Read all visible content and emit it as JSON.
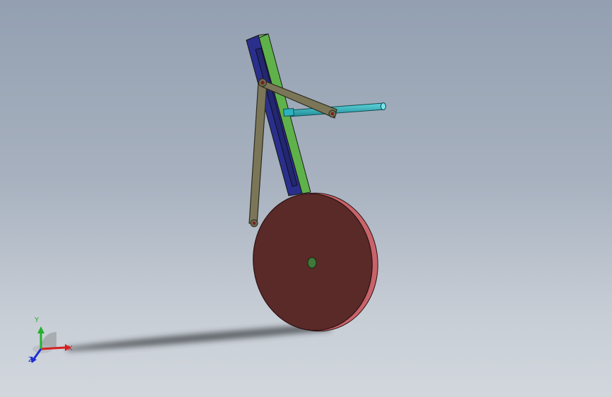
{
  "viewport": {
    "background_top": "#93a0b1",
    "background_bottom": "#d2d7de"
  },
  "model": {
    "parts": [
      {
        "name": "slotted-guide-bar",
        "color": "#2b2f8c",
        "edge_color": "#5fb24a"
      },
      {
        "name": "slider-rod",
        "color": "#2bb3bf"
      },
      {
        "name": "crank-link",
        "color": "#7b7658"
      },
      {
        "name": "connecting-link",
        "color": "#7b7658"
      },
      {
        "name": "flywheel-disc",
        "color": "#5a2a28",
        "rim_color": "#c9636a"
      },
      {
        "name": "disc-hub",
        "color": "#3f7a3a"
      }
    ]
  },
  "triad": {
    "x_label": "X",
    "y_label": "Y",
    "z_label": "Z",
    "x_color": "#d42020",
    "y_color": "#22b12a",
    "z_color": "#1c2fd0"
  }
}
